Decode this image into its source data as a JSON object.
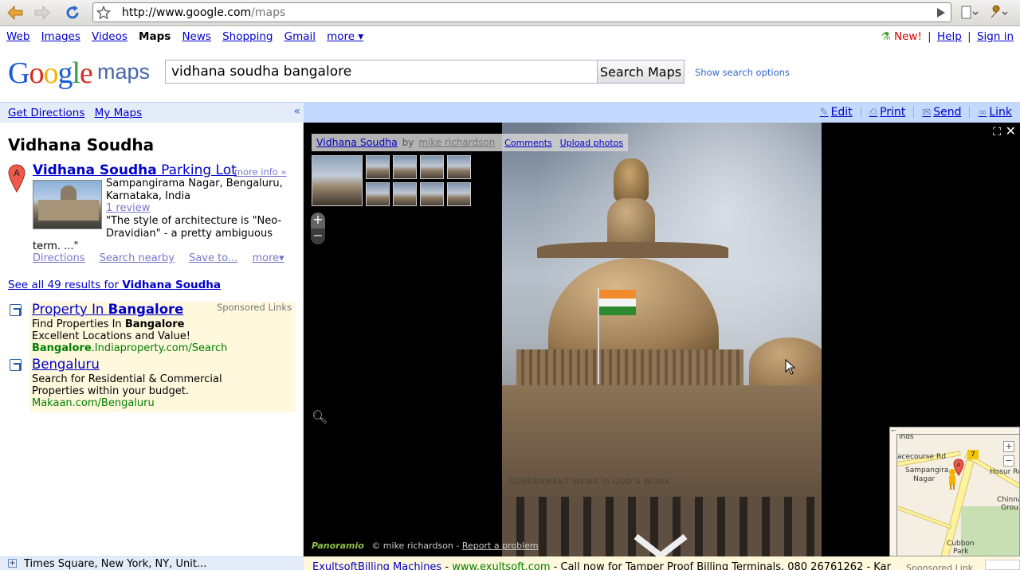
{
  "browser": {
    "url_host": "http://www.google.com",
    "url_path": "/maps"
  },
  "gbar": {
    "links": [
      "Web",
      "Images",
      "Videos",
      "Maps",
      "News",
      "Shopping",
      "Gmail",
      "more ▾"
    ],
    "current": "Maps",
    "new_label": "New!",
    "help": "Help",
    "sign_in": "Sign in",
    "sep": "|"
  },
  "header": {
    "logo_google": "Google",
    "logo_maps": "maps",
    "search_value": "vidhana soudha bangalore",
    "search_button": "Search Maps",
    "search_options": "Show search options"
  },
  "panel": {
    "get_directions": "Get Directions",
    "my_maps": "My Maps",
    "collapse": "«"
  },
  "map_tools": {
    "edit": "Edit",
    "print": "Print",
    "send": "Send",
    "link": "Link"
  },
  "result": {
    "heading": "Vidhana Soudha",
    "marker_letter": "A",
    "title_bold": "Vidhana Soudha",
    "title_rest": " Parking Lot",
    "title_dash": " - ",
    "more_info": "more info »",
    "address_line1": "Sampangirama Nagar, Bengaluru,",
    "address_line2": "Karnataka, India",
    "review": "1 review",
    "snippet_line1": "\"The style of architecture is \"Neo-",
    "snippet_line2": "Dravidian\" - a pretty ambiguous",
    "snippet_line3": "term. ...\"",
    "links": [
      "Directions",
      "Search nearby",
      "Save to...",
      "more▾"
    ],
    "see_all_prefix": "See all 49 results for ",
    "see_all_bold": "Vidhana Soudha"
  },
  "ads": {
    "label": "Sponsored Links",
    "items": [
      {
        "title_pre": "Property In ",
        "title_bold": "Bangalore",
        "line1_pre": "Find Properties In ",
        "line1_bold": "Bangalore",
        "line2": "Excellent Locations and Value!",
        "url_bold": "Bangalore",
        "url_rest": ".Indiaproperty.com/Search"
      },
      {
        "title": "Bengaluru",
        "line1": "Search for Residential & Commercial",
        "line2": "Properties within your budget.",
        "url": "Makaan.com/Bengaluru"
      }
    ]
  },
  "panoramio": {
    "title": "Vidhana Soudha",
    "by": "by",
    "author": "mike richardson",
    "comments": "Comments",
    "upload": "Upload photos",
    "brand": "Panoramio",
    "credit": "© mike richardson -",
    "report": "Report a problem",
    "engraving": "GOVERNMENT WORK IS GOD'S WORK",
    "zoom_plus": "+",
    "zoom_minus": "−"
  },
  "overview_map": {
    "labels": [
      "inds",
      "acecourse Rd",
      "Sampangira",
      "Nagar",
      "Hosur Rd",
      "Chinnas",
      "Grou",
      "Cubbon",
      "Park"
    ],
    "highway": "7",
    "marker": "A",
    "zoom_plus": "+",
    "zoom_minus": "−"
  },
  "bottom": {
    "location": "Times Square, New York, NY, Unit...",
    "ad_title": "ExultsoftBilling Machines",
    "ad_dash": " - ",
    "ad_url": "www.exultsoft.com",
    "ad_text": " - Call now for Tamper Proof Billing Terminals. 080 26761262 - Kar",
    "ad_label": "Sponsored Link"
  },
  "colors": {
    "link": "#0000cc",
    "toolbar_blue": "#c3d9ff",
    "ad_bg": "#fff8dd",
    "ad_url": "#008000"
  }
}
